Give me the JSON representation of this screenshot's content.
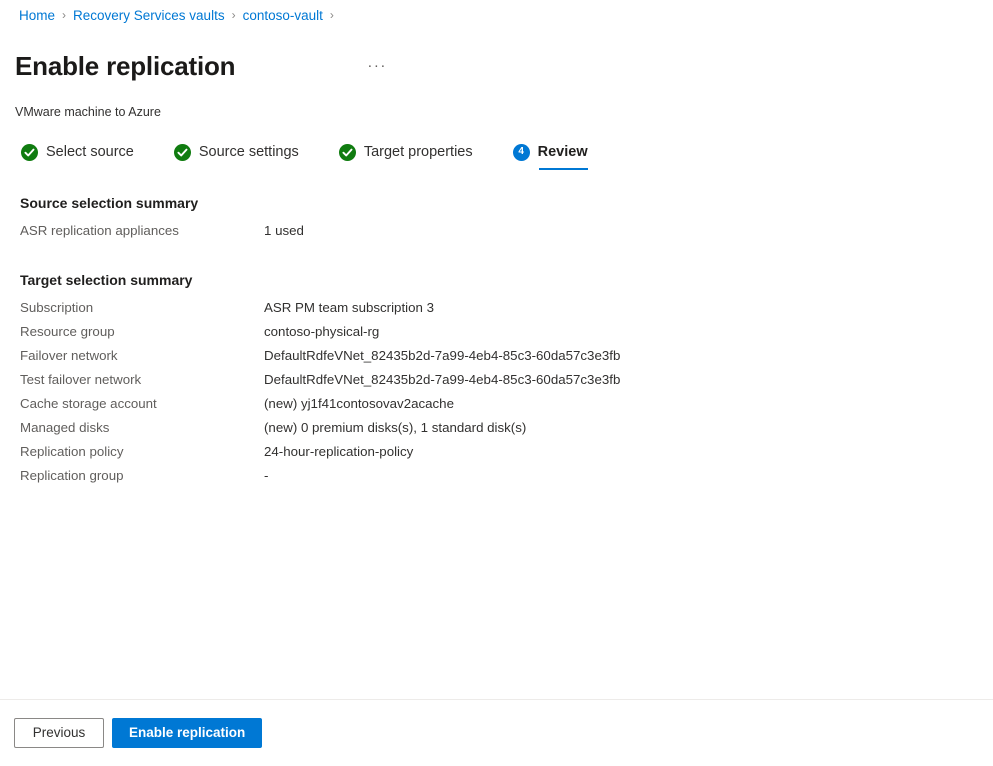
{
  "breadcrumb": {
    "items": [
      {
        "label": "Home"
      },
      {
        "label": "Recovery Services vaults"
      },
      {
        "label": "contoso-vault"
      }
    ],
    "separator": "›"
  },
  "header": {
    "title": "Enable replication",
    "subtitle": "VMware machine to Azure",
    "more_menu": "···"
  },
  "wizard": {
    "tabs": [
      {
        "label": "Select source",
        "state": "complete",
        "icon": "check-circle-icon"
      },
      {
        "label": "Source settings",
        "state": "complete",
        "icon": "check-circle-icon"
      },
      {
        "label": "Target properties",
        "state": "complete",
        "icon": "check-circle-icon"
      },
      {
        "label": "Review",
        "state": "active",
        "number": "4"
      }
    ]
  },
  "source_summary": {
    "heading": "Source selection summary",
    "rows": [
      {
        "label": "ASR replication appliances",
        "value": "1 used"
      }
    ]
  },
  "target_summary": {
    "heading": "Target selection summary",
    "rows": [
      {
        "label": "Subscription",
        "value": "ASR PM team subscription 3"
      },
      {
        "label": "Resource group",
        "value": "contoso-physical-rg"
      },
      {
        "label": "Failover network",
        "value": "DefaultRdfeVNet_82435b2d-7a99-4eb4-85c3-60da57c3e3fb"
      },
      {
        "label": "Test failover network",
        "value": "DefaultRdfeVNet_82435b2d-7a99-4eb4-85c3-60da57c3e3fb"
      },
      {
        "label": "Cache storage account",
        "value": "(new) yj1f41contosovav2acache"
      },
      {
        "label": "Managed disks",
        "value": "(new) 0 premium disks(s), 1 standard disk(s)"
      },
      {
        "label": "Replication policy",
        "value": "24-hour-replication-policy"
      },
      {
        "label": "Replication group",
        "value": "-"
      }
    ]
  },
  "footer": {
    "previous_label": "Previous",
    "enable_label": "Enable replication"
  },
  "colors": {
    "accent": "#0078d4",
    "success": "#107c10",
    "link": "#0078d4",
    "label_text": "#605e5c"
  }
}
